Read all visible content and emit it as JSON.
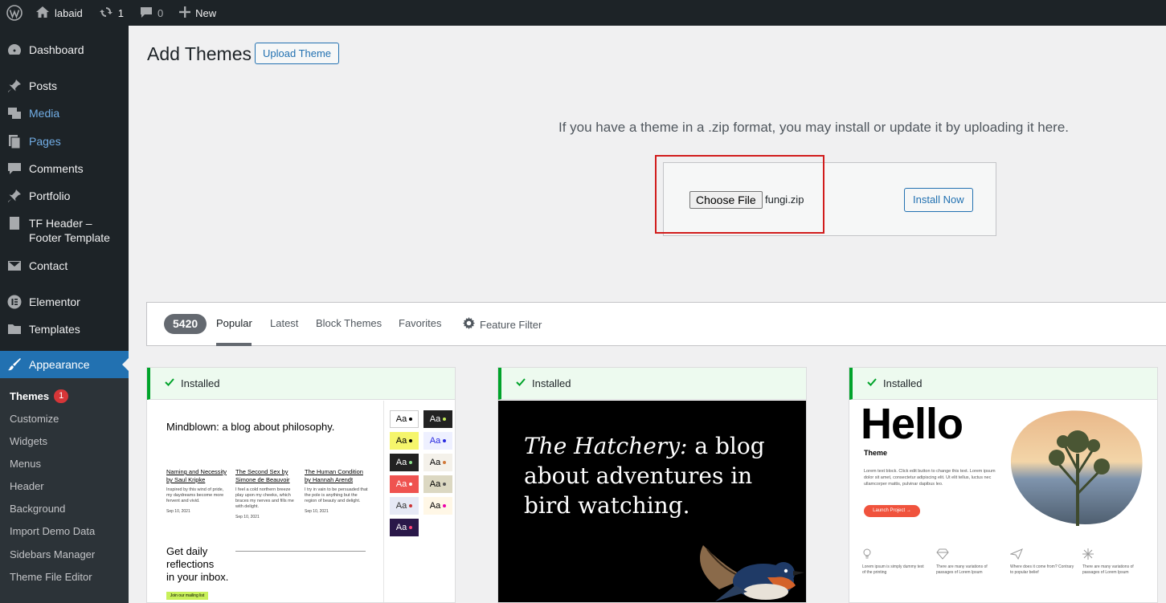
{
  "admin_bar": {
    "site_name": "labaid",
    "updates_count": "1",
    "comments_count": "0",
    "new_label": "New"
  },
  "sidebar": {
    "items": [
      {
        "label": "Dashboard",
        "icon": "dashboard-icon"
      },
      {
        "label": "Posts",
        "icon": "pin-icon"
      },
      {
        "label": "Media",
        "icon": "media-icon"
      },
      {
        "label": "Pages",
        "icon": "pages-icon"
      },
      {
        "label": "Comments",
        "icon": "comment-icon"
      },
      {
        "label": "Portfolio",
        "icon": "pin-icon"
      },
      {
        "label": "TF Header –\nFooter Template",
        "icon": "page-icon"
      },
      {
        "label": "Contact",
        "icon": "mail-icon"
      },
      {
        "label": "Elementor",
        "icon": "elementor-icon"
      },
      {
        "label": "Templates",
        "icon": "folder-icon"
      },
      {
        "label": "Appearance",
        "icon": "brush-icon"
      }
    ],
    "submenu": [
      {
        "label": "Themes",
        "badge": "1"
      },
      {
        "label": "Customize"
      },
      {
        "label": "Widgets"
      },
      {
        "label": "Menus"
      },
      {
        "label": "Header"
      },
      {
        "label": "Background"
      },
      {
        "label": "Import Demo Data"
      },
      {
        "label": "Sidebars Manager"
      },
      {
        "label": "Theme File Editor"
      }
    ]
  },
  "page": {
    "title": "Add Themes",
    "upload_button": "Upload Theme",
    "upload_help": "If you have a theme in a .zip format, you may install or update it by uploading it here.",
    "choose_file": "Choose File",
    "file_name": "fungi.zip",
    "install_button": "Install Now"
  },
  "filter": {
    "count": "5420",
    "tabs": [
      "Popular",
      "Latest",
      "Block Themes",
      "Favorites"
    ],
    "feature_filter": "Feature Filter"
  },
  "themes": [
    {
      "notice": "Installed",
      "preview": {
        "title": "Mindblown: a blog about philosophy.",
        "posts": [
          {
            "title": "Naming and Necessity by Saul Kripke",
            "body": "Inspired by this wind of pride, my daydreams become more fervent and vivid.",
            "date": "Sep 10, 2021"
          },
          {
            "title": "The Second Sex by Simone de Beauvoir",
            "body": "I feel a cold northern breeze play upon my cheeks, which braces my nerves and fills me with delight.",
            "date": "Sep 10, 2021"
          },
          {
            "title": "The Human Condition by Hannah Arendt",
            "body": "I try in vain to be persuaded that the pole is anything but the region of beauty and delight.",
            "date": "Sep 10, 2021"
          }
        ],
        "cta": "Get daily\nreflections\nin your inbox.",
        "cta_button": "Join our mailing list",
        "swatch_label": "Aa"
      }
    },
    {
      "notice": "Installed",
      "preview": {
        "italic": "The Hatchery:",
        "rest": " a blog about adventures in bird watching."
      }
    },
    {
      "notice": "Installed",
      "preview": {
        "title": "Hello",
        "subtitle": "Theme",
        "body": "Lorem text block. Click edit button to change this text. Lorem ipsum dolor sit amet, consectetur adipiscing elit. Ut elit tellus, luctus nec ullamcorper mattis, pulvinar dapibus leo.",
        "button": "Launch Project →",
        "features": [
          "Lorem ipsum is simply dummy text of the printing",
          "There are many variations of passages of Lorem Ipsum",
          "Where does it come from? Contrary to popular belief",
          "There are many variations of passages of Lorem Ipsum"
        ]
      }
    }
  ],
  "colors": {
    "admin_dark": "#1d2327",
    "accent_blue": "#2271b1",
    "highlight_red": "#d11c1c",
    "installed_green": "#00a32a"
  }
}
